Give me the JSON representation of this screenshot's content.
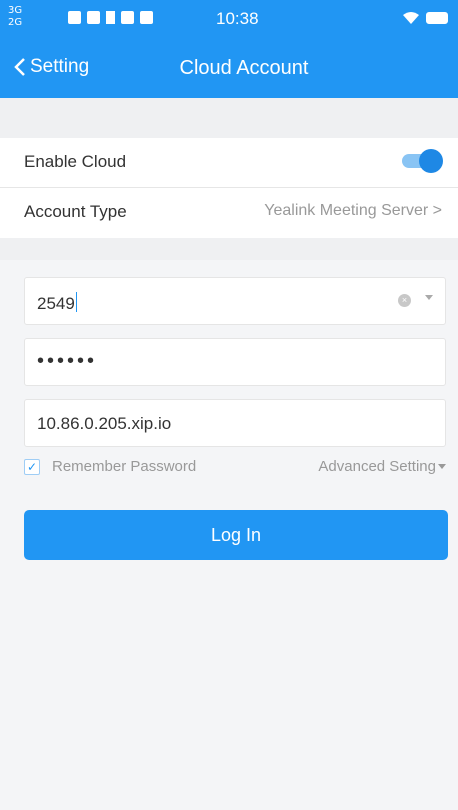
{
  "status_bar": {
    "network_top": "3G",
    "network_bottom": "2G",
    "time": "10:38"
  },
  "navbar": {
    "back_label": "Setting",
    "title": "Cloud Account"
  },
  "settings": {
    "enable_cloud_label": "Enable Cloud",
    "enable_cloud_on": true,
    "account_type_label": "Account Type",
    "account_type_value": "Yealink Meeting Server >"
  },
  "form": {
    "account_value": "2549",
    "password_value": "••••••",
    "server_value": "10.86.0.205.xip.io",
    "remember_label": "Remember Password",
    "remember_checked": true,
    "advanced_label": "Advanced Setting",
    "login_label": "Log In"
  },
  "colors": {
    "accent": "#2196f3",
    "background": "#f4f5f7"
  }
}
